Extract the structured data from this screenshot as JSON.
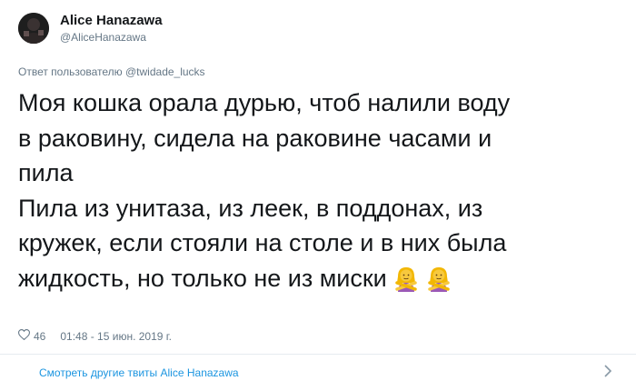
{
  "author": {
    "display_name": "Alice Hanazawa",
    "handle": "@AliceHanazawa"
  },
  "reply_to": "Ответ пользователю @twidade_lucks",
  "tweet": {
    "lines": [
      "Моя кошка орала дурью, чтоб налили воду",
      "в раковину, сидела на раковине часами и",
      "пила",
      "Пила из унитаза, из леек, в поддонах, из",
      "кружек, если стояли на столе и в них была",
      "жидкость, но только не из миски"
    ],
    "emojis": [
      "woman-gesturing-no-emoji",
      "woman-gesturing-no-emoji"
    ]
  },
  "meta": {
    "likes": "46",
    "timestamp": "01:48 - 15 июн. 2019 г."
  },
  "footer": {
    "link_text": "Смотреть другие твиты Alice Hanazawa"
  },
  "colors": {
    "text": "#14171a",
    "secondary": "#657786",
    "link": "#1b95e0",
    "divider": "#e6ecf0",
    "emoji_skin": "#f7c93e",
    "emoji_shirt": "#9b59b6"
  }
}
